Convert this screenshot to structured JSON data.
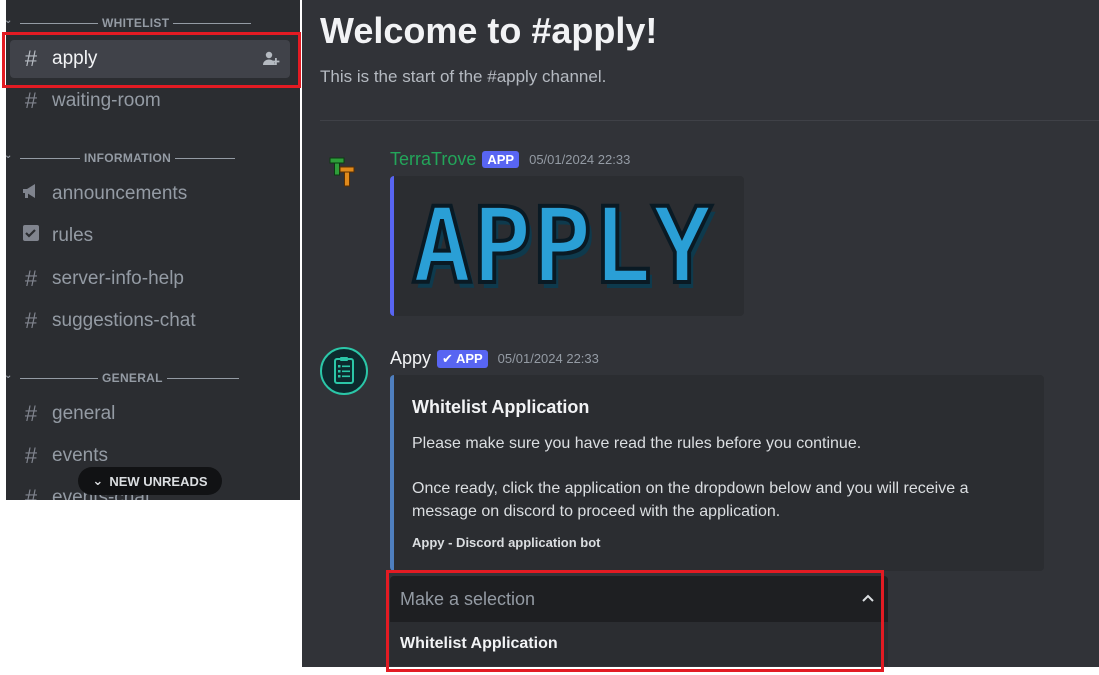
{
  "sidebar": {
    "categories": [
      {
        "label": "WHITELIST"
      },
      {
        "label": "INFORMATION"
      },
      {
        "label": "GENERAL"
      }
    ],
    "channels": [
      {
        "name": "apply",
        "icon": "hash-icon"
      },
      {
        "name": "waiting-room",
        "icon": "hash-icon"
      },
      {
        "name": "announcements",
        "icon": "megaphone-icon"
      },
      {
        "name": "rules",
        "icon": "rules-checkbox-icon"
      },
      {
        "name": "server-info-help",
        "icon": "hash-icon"
      },
      {
        "name": "suggestions-chat",
        "icon": "hash-icon"
      },
      {
        "name": "general",
        "icon": "hash-icon"
      },
      {
        "name": "events",
        "icon": "hash-icon"
      },
      {
        "name": "events-chat",
        "icon": "hash-icon"
      }
    ],
    "unreads_pill": "NEW UNREADS"
  },
  "channel": {
    "welcome_title": "Welcome to #apply!",
    "welcome_sub": "This is the start of the #apply channel."
  },
  "messages": [
    {
      "author": "TerraTrove",
      "author_color": "#23a55a",
      "badge": "APP",
      "timestamp": "05/01/2024 22:33",
      "image_text": "APPLY"
    },
    {
      "author": "Appy",
      "author_color": "#f2f3f5",
      "badge": "APP",
      "badge_verified": true,
      "timestamp": "05/01/2024 22:33",
      "embed": {
        "title": "Whitelist Application",
        "p1": "Please make sure you have read the rules before you continue.",
        "p2": "Once ready, click the application on the dropdown below and you will receive a message on discord to proceed with the application.",
        "footer": "Appy - Discord application bot"
      },
      "select": {
        "placeholder": "Make a selection",
        "options": [
          "Whitelist Application"
        ]
      }
    }
  ],
  "colors": {
    "accent": "#5865f2",
    "highlight": "#e31b23"
  }
}
